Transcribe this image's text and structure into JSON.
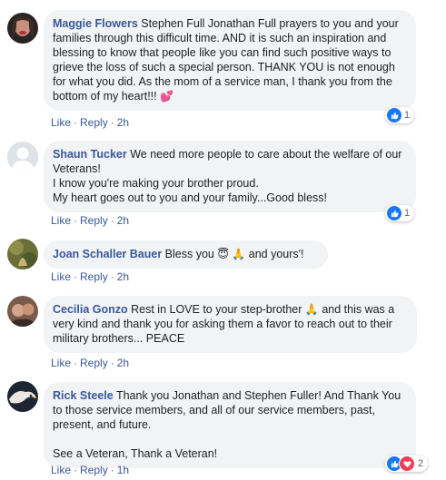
{
  "comments": [
    {
      "author": "Maggie Flowers",
      "text": " Stephen Full Jonathan Full prayers to you and your families through this difficult time. AND it is such an inspiration and blessing to know that people like you can find such positive ways to grieve the loss of such a special person. THANK YOU is not enough for what you did. As the mom of a service man, I thank you from the bottom of my heart!!! ",
      "emoji_after": "💕",
      "like_label": "Like",
      "reply_label": "Reply",
      "time": "2h",
      "reaction_count": "1"
    },
    {
      "author": "Shaun Tucker",
      "text": " We need more people to care about the welfare of our Veterans!\nI know you're making your brother proud.\nMy heart goes out to you and your family...Good bless!",
      "like_label": "Like",
      "reply_label": "Reply",
      "time": "2h",
      "reaction_count": "1"
    },
    {
      "author": "Joan Schaller Bauer",
      "text_before": " Bless you ",
      "emoji_1": "😇",
      "emoji_2": "🙏",
      "text_after": " and yours'!",
      "like_label": "Like",
      "reply_label": "Reply",
      "time": "2h"
    },
    {
      "author": "Cecilia Gonzo",
      "text_before": " Rest in LOVE to your step-brother ",
      "emoji_1": "🙏",
      "text_after": " and this was a very kind and thank you for asking them a favor to reach out to their military brothers... PEACE",
      "like_label": "Like",
      "reply_label": "Reply",
      "time": "2h"
    },
    {
      "author": "Rick Steele",
      "text": " Thank you Jonathan and Stephen Fuller! And Thank You to those service members, and all of our service members, past, present, and future.\n\nSee a Veteran, Thank a Veteran!",
      "like_label": "Like",
      "reply_label": "Reply",
      "time": "1h",
      "reaction_count": "2"
    }
  ]
}
